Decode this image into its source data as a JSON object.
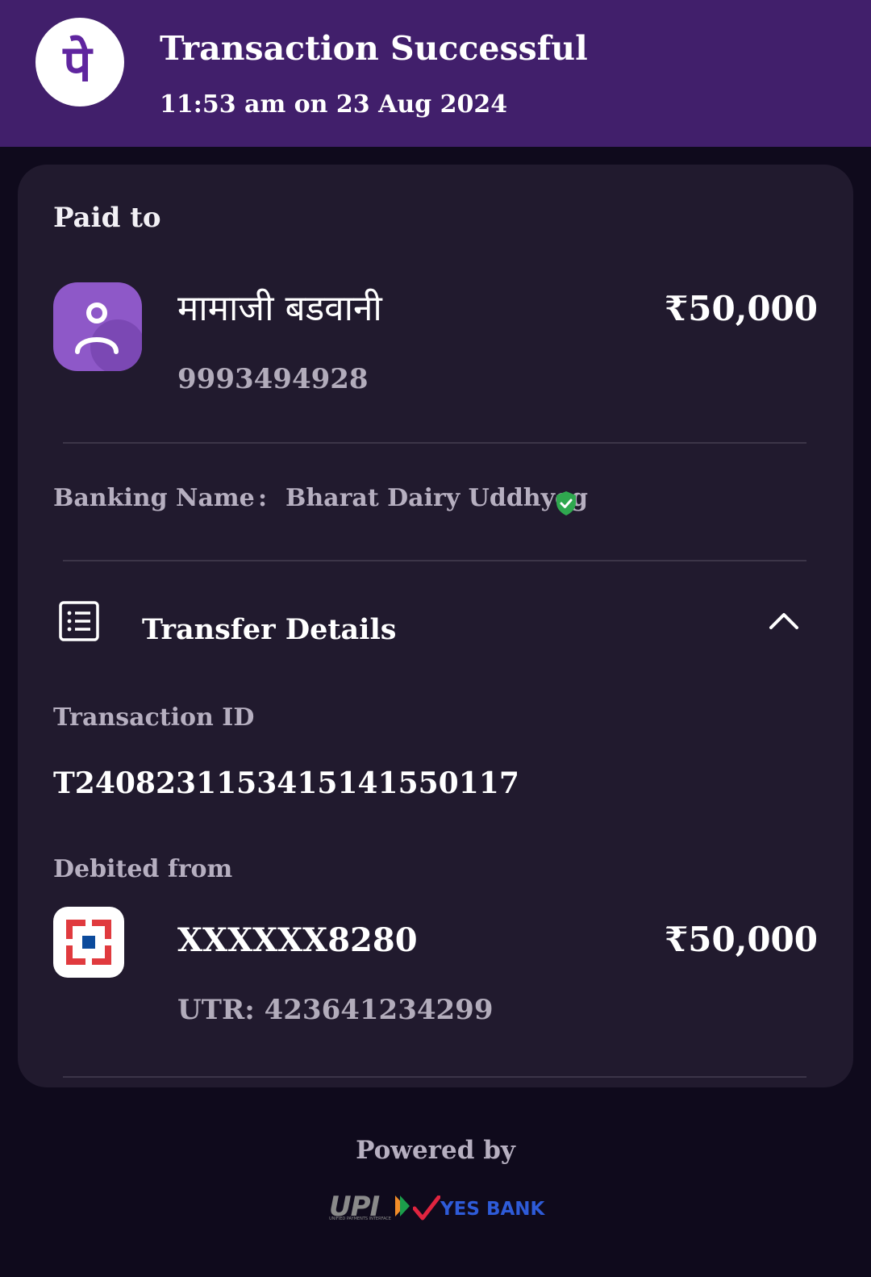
{
  "header": {
    "title": "Transaction Successful",
    "timestamp": "11:53 am on 23 Aug 2024",
    "logo_icon": "phonepe-logo-icon",
    "logo_glyph": "पे",
    "background_color": "#411f6b"
  },
  "payment": {
    "section_label": "Paid to",
    "payee_name": "मामाजी बडवानी",
    "payee_phone": "9993494928",
    "amount": "₹50,000",
    "avatar_icon": "person-icon"
  },
  "banking": {
    "label": "Banking Name",
    "separator": ":",
    "value": "Bharat Dairy Uddhyog",
    "verified_icon": "verified-shield-icon",
    "verified_color": "#2fa84f"
  },
  "transfer_details": {
    "title": "Transfer Details",
    "icon": "list-icon",
    "toggle_icon": "chevron-up-icon",
    "transaction_id_label": "Transaction ID",
    "transaction_id": "T2408231153415141550117",
    "debited_from_label": "Debited from",
    "bank_icon": "hdfc-bank-icon",
    "account": "XXXXXX8280",
    "debited_amount": "₹50,000",
    "utr": "UTR: 423641234299"
  },
  "footer": {
    "powered_by": "Powered by",
    "upi_text": "UPI",
    "upi_subtext": "UNIFIED PAYMENTS INTERFACE",
    "bank_text": "YES BANK"
  }
}
